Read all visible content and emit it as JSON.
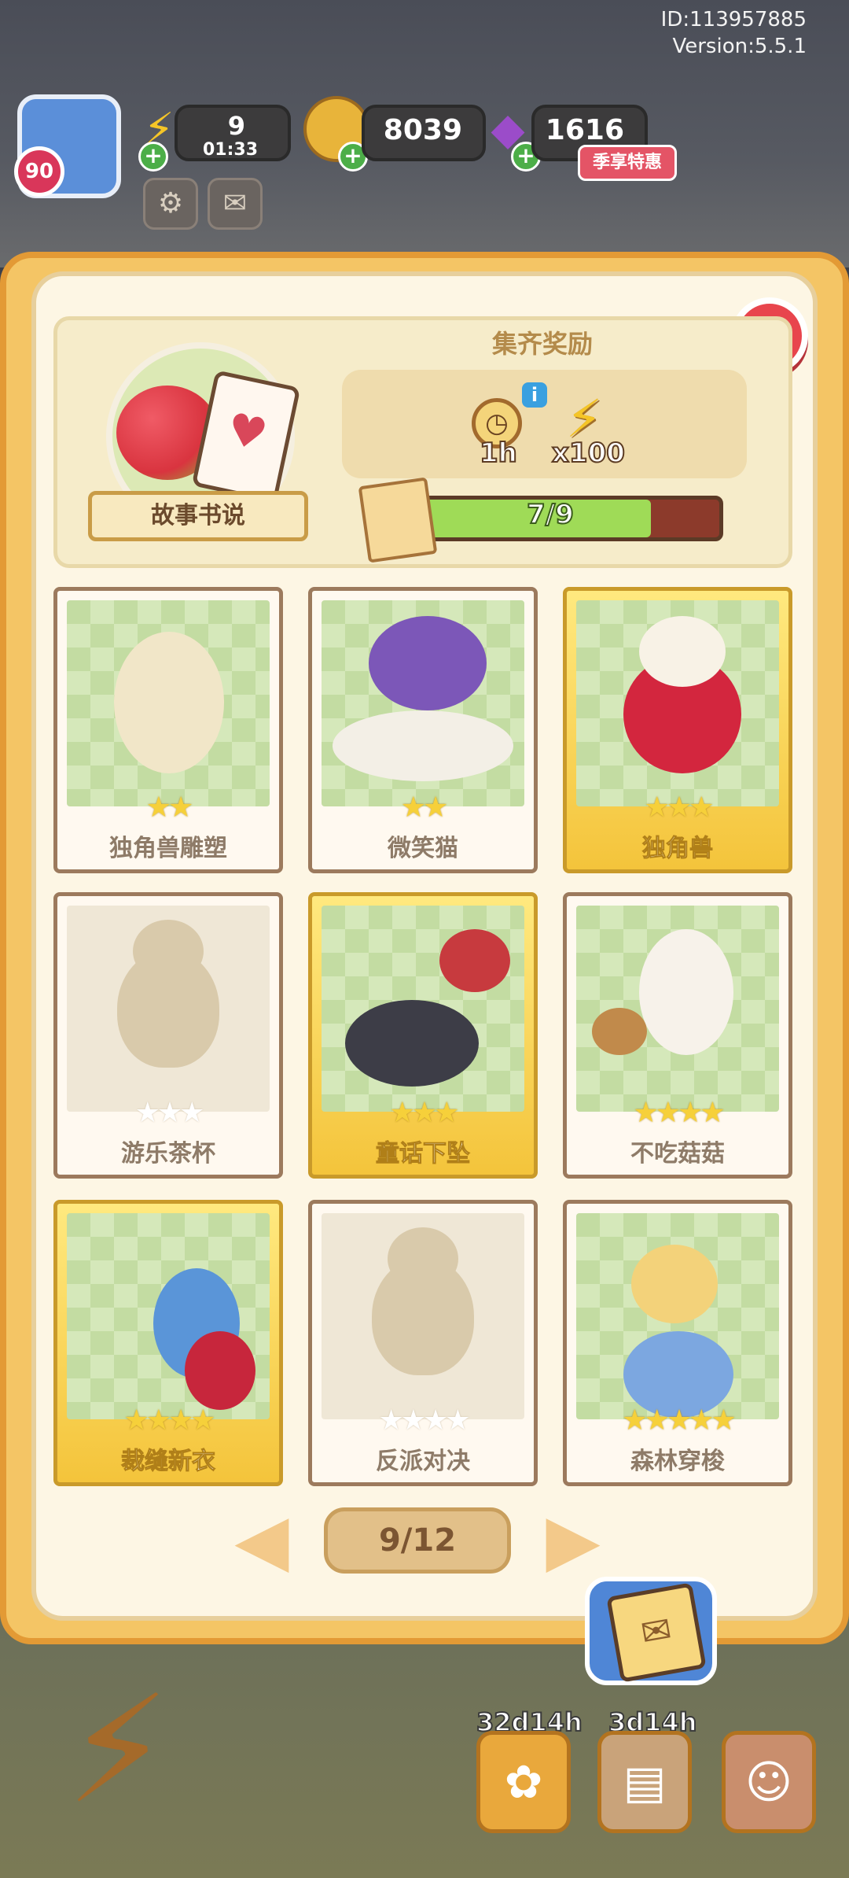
{
  "meta": {
    "id": "ID:113957885",
    "version": "Version:5.5.1"
  },
  "hud": {
    "level": "90",
    "energy": "9",
    "energy_timer": "01:33",
    "coins": "8039",
    "gems": "1616",
    "season_tag": "季享特惠"
  },
  "album": {
    "name": "故事书说",
    "reward_title": "集齐奖励",
    "reward_time": "1h",
    "reward_energy": "x100",
    "progress_text": "7/9",
    "progress_fraction": 0.778
  },
  "cards": [
    {
      "name": "独角兽雕塑",
      "stars": 2,
      "gold": false,
      "locked": false
    },
    {
      "name": "微笑猫",
      "stars": 2,
      "gold": false,
      "locked": false
    },
    {
      "name": "独角兽",
      "stars": 3,
      "gold": true,
      "locked": false
    },
    {
      "name": "游乐茶杯",
      "stars": 3,
      "gold": false,
      "locked": true
    },
    {
      "name": "童话下坠",
      "stars": 3,
      "gold": true,
      "locked": false
    },
    {
      "name": "不吃菇菇",
      "stars": 4,
      "gold": false,
      "locked": false
    },
    {
      "name": "裁缝新衣",
      "stars": 4,
      "gold": true,
      "locked": false
    },
    {
      "name": "反派对决",
      "stars": 4,
      "gold": false,
      "locked": true
    },
    {
      "name": "森林穿梭",
      "stars": 5,
      "gold": false,
      "locked": false
    }
  ],
  "pager": {
    "page": "9/12"
  },
  "bottom": {
    "timer_left": "32d14h",
    "timer_right": "3d14h"
  }
}
